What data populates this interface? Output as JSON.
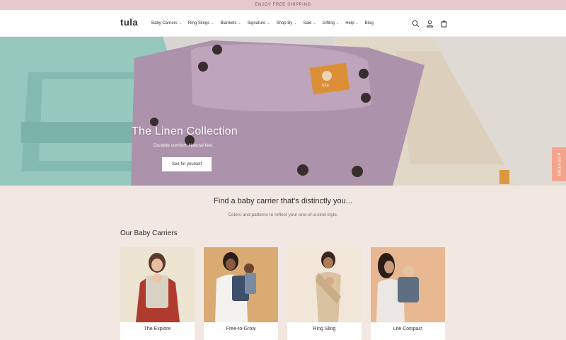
{
  "announcement": {
    "text": "ENJOY FREE SHIPPING"
  },
  "header": {
    "logo": "tula",
    "nav": [
      {
        "label": "Baby Carriers",
        "has_dropdown": true
      },
      {
        "label": "Ring Slings",
        "has_dropdown": true
      },
      {
        "label": "Blankets",
        "has_dropdown": true
      },
      {
        "label": "Signature",
        "has_dropdown": true
      },
      {
        "label": "Shop By",
        "has_dropdown": true
      },
      {
        "label": "Sale",
        "has_dropdown": true
      },
      {
        "label": "Gifting",
        "has_dropdown": true
      },
      {
        "label": "Help",
        "has_dropdown": true
      },
      {
        "label": "Blog",
        "has_dropdown": false
      }
    ],
    "icons": [
      "search-icon",
      "account-icon",
      "cart-icon"
    ]
  },
  "hero": {
    "title": "The Linen Collection",
    "subtitle": "Durable comfort. Natural feel.",
    "cta": "See for yourself",
    "badge": "tula",
    "side_tab": "★ REVIEWS"
  },
  "intro": {
    "title": "Find a baby carrier that's distinctly you...",
    "subtitle": "Colors and patterns to reflect your one-of-a-kind-style."
  },
  "carriers": {
    "heading": "Our Baby Carriers",
    "items": [
      {
        "label": "The Explore",
        "bg": "#eee4d2"
      },
      {
        "label": "Free-to-Grow",
        "bg": "#d9ab72"
      },
      {
        "label": "Ring Sling",
        "bg": "#f1e6d8"
      },
      {
        "label": "Lite Compact",
        "bg": "#e7b892"
      }
    ]
  },
  "colors": {
    "accent": "#f2a58c",
    "announce_bg": "#e9c8cb",
    "page_bg": "#f3e7e1"
  }
}
